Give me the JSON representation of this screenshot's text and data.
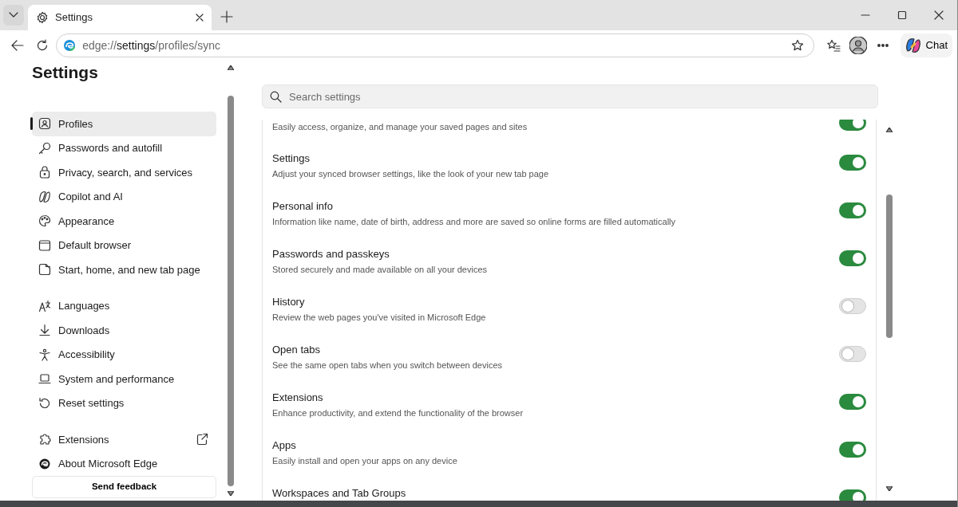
{
  "tab": {
    "title": "Settings",
    "selected": true
  },
  "address": {
    "scheme": "edge://",
    "host": "settings",
    "path": "/profiles/sync"
  },
  "chat_button": "Chat",
  "sidebar": {
    "title": "Settings",
    "groups": [
      [
        {
          "label": "Profiles",
          "selected": true,
          "external_link": false
        },
        {
          "label": "Passwords and autofill",
          "selected": false,
          "external_link": false
        },
        {
          "label": "Privacy, search, and services",
          "selected": false,
          "external_link": false
        },
        {
          "label": "Copilot and AI",
          "selected": false,
          "external_link": false
        },
        {
          "label": "Appearance",
          "selected": false,
          "external_link": false
        },
        {
          "label": "Default browser",
          "selected": false,
          "external_link": false
        },
        {
          "label": "Start, home, and new tab page",
          "selected": false,
          "external_link": false
        }
      ],
      [
        {
          "label": "Languages",
          "selected": false,
          "external_link": false
        },
        {
          "label": "Downloads",
          "selected": false,
          "external_link": false
        },
        {
          "label": "Accessibility",
          "selected": false,
          "external_link": false
        },
        {
          "label": "System and performance",
          "selected": false,
          "external_link": false
        },
        {
          "label": "Reset settings",
          "selected": false,
          "external_link": false
        }
      ],
      [
        {
          "label": "Extensions",
          "selected": false,
          "external_link": true
        },
        {
          "label": "About Microsoft Edge",
          "selected": false,
          "external_link": false
        }
      ]
    ],
    "feedback_button": "Send feedback"
  },
  "search": {
    "placeholder": "Search settings"
  },
  "sync_items": [
    {
      "description": "Easily access, organize, and manage your saved pages and sites",
      "on": true
    },
    {
      "title": "Settings",
      "description": "Adjust your synced browser settings, like the look of your new tab page",
      "on": true
    },
    {
      "title": "Personal info",
      "description": "Information like name, date of birth, address and more are saved so online forms are filled automatically",
      "on": true
    },
    {
      "title": "Passwords and passkeys",
      "description": "Stored securely and made available on all your devices",
      "on": true
    },
    {
      "title": "History",
      "description": "Review the web pages you've visited in Microsoft Edge",
      "on": false
    },
    {
      "title": "Open tabs",
      "description": "See the same open tabs when you switch between devices",
      "on": false
    },
    {
      "title": "Extensions",
      "description": "Enhance productivity, and extend the functionality of the browser",
      "on": true
    },
    {
      "title": "Apps",
      "description": "Easily install and open your apps on any device",
      "on": true
    },
    {
      "title": "Workspaces and Tab Groups",
      "on": true
    }
  ]
}
